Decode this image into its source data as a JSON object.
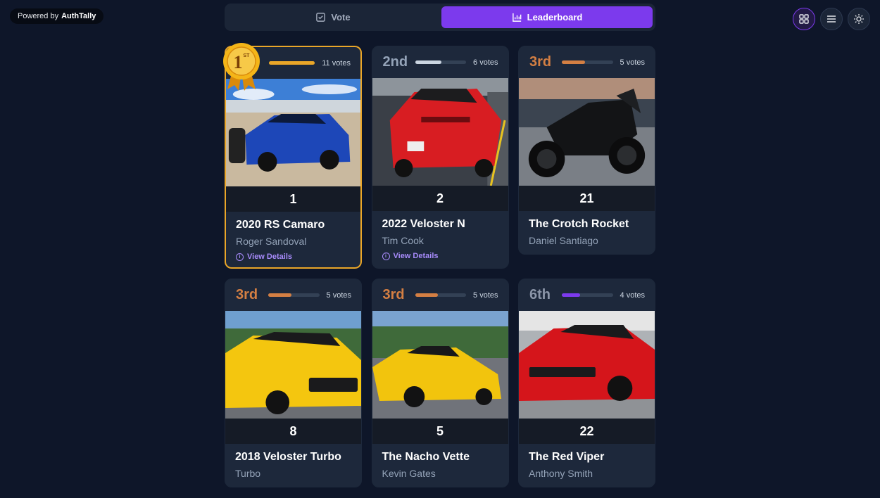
{
  "brand": {
    "powered_by": "Powered by",
    "name": "AuthTally"
  },
  "tabs": [
    {
      "label": "Vote",
      "icon": "checkbox-icon",
      "active": false
    },
    {
      "label": "Leaderboard",
      "icon": "bar-chart-icon",
      "active": true
    }
  ],
  "toolbar": {
    "grid_view": "grid-icon",
    "list_view": "menu-icon",
    "theme": "sun-icon"
  },
  "colors": {
    "accent": "#7c3aed",
    "gold": "#eaa628",
    "silver": "#cbd5e1",
    "bronze": "#d47f43",
    "purple": "#7c3aed",
    "card": "#1d283b",
    "bg": "#0e1629"
  },
  "view_details_label": "View Details",
  "badge": {
    "text": "1",
    "sup": "ST"
  },
  "entries": [
    {
      "rank": "",
      "votes": "11 votes",
      "vote_fraction": 1.0,
      "bar_color": "#eaa628",
      "number": "1",
      "title": "2020 RS Camaro",
      "owner": "Roger Sandoval",
      "details": true,
      "photo": "blue-camaro"
    },
    {
      "rank": "2nd",
      "votes": "6 votes",
      "vote_fraction": 0.52,
      "bar_color": "#cbd5e1",
      "number": "2",
      "title": "2022 Veloster N",
      "owner": "Tim Cook",
      "details": true,
      "photo": "red-veloster"
    },
    {
      "rank": "3rd",
      "votes": "5 votes",
      "vote_fraction": 0.45,
      "bar_color": "#d47f43",
      "number": "21",
      "title": "The Crotch Rocket",
      "owner": "Daniel Santiago",
      "details": false,
      "photo": "black-motorcycle"
    },
    {
      "rank": "3rd",
      "votes": "5 votes",
      "vote_fraction": 0.45,
      "bar_color": "#d47f43",
      "number": "8",
      "title": "2018 Veloster Turbo",
      "owner": "Turbo",
      "details": false,
      "photo": "yellow-veloster"
    },
    {
      "rank": "3rd",
      "votes": "5 votes",
      "vote_fraction": 0.45,
      "bar_color": "#d47f43",
      "number": "5",
      "title": "The Nacho Vette",
      "owner": "Kevin Gates",
      "details": false,
      "photo": "yellow-corvette"
    },
    {
      "rank": "6th",
      "votes": "4 votes",
      "vote_fraction": 0.36,
      "bar_color": "#7c3aed",
      "number": "22",
      "title": "The Red Viper",
      "owner": "Anthony Smith",
      "details": false,
      "photo": "red-camaro"
    }
  ]
}
